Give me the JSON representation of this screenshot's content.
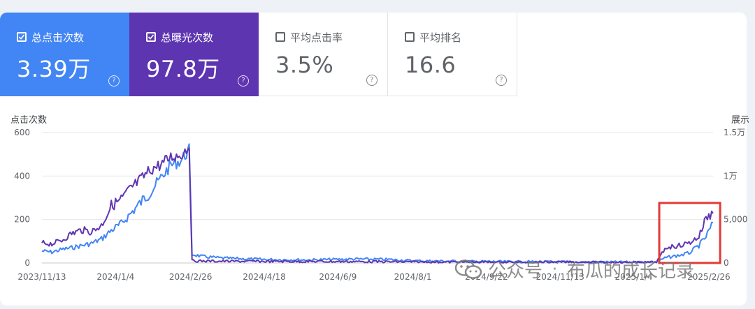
{
  "metrics": [
    {
      "label": "总点击次数",
      "value": "3.39万",
      "checked": true,
      "help": "?"
    },
    {
      "label": "总曝光次数",
      "value": "97.8万",
      "checked": true,
      "help": "?"
    },
    {
      "label": "平均点击率",
      "value": "3.5%",
      "checked": false,
      "help": "?"
    },
    {
      "label": "平均排名",
      "value": "16.6",
      "checked": false,
      "help": "?"
    }
  ],
  "colors": {
    "clicks": "#4285f4",
    "impressions": "#5e35b1",
    "highlight": "#e53935"
  },
  "watermark": {
    "prefix": "公众号",
    "separator": "·",
    "name": "布瓜的成长记录"
  },
  "chart_data": {
    "type": "line",
    "ylabel_left": "点击次数",
    "ylabel_right": "展示",
    "yticks_left": [
      "0",
      "200",
      "400",
      "600"
    ],
    "yticks_right": [
      "0",
      "5,000",
      "1万",
      "1.5万"
    ],
    "ylim_left": [
      0,
      600
    ],
    "ylim_right": [
      0,
      15000
    ],
    "xticks": [
      "2023/11/13",
      "2024/1/4",
      "2024/2/26",
      "2024/4/18",
      "2024/6/9",
      "2024/8/1",
      "2024/9/22",
      "2024/11/13",
      "2025/1/4",
      "2025/2/26"
    ],
    "x_range": [
      "2023/11/13",
      "2025/3/1"
    ],
    "grid": true,
    "series": [
      {
        "name": "总点击次数",
        "axis": "left",
        "color": "#4285f4",
        "points": [
          [
            "2023/11/13",
            55
          ],
          [
            "2023/11/20",
            50
          ],
          [
            "2023/11/27",
            62
          ],
          [
            "2023/12/4",
            70
          ],
          [
            "2023/12/11",
            80
          ],
          [
            "2023/12/18",
            90
          ],
          [
            "2023/12/25",
            110
          ],
          [
            "2024/1/1",
            150
          ],
          [
            "2024/1/8",
            180
          ],
          [
            "2024/1/15",
            230
          ],
          [
            "2024/1/22",
            280
          ],
          [
            "2024/1/29",
            330
          ],
          [
            "2024/2/5",
            390
          ],
          [
            "2024/2/12",
            450
          ],
          [
            "2024/2/19",
            470
          ],
          [
            "2024/2/25",
            520
          ],
          [
            "2024/2/27",
            40
          ],
          [
            "2024/3/5",
            30
          ],
          [
            "2024/3/20",
            22
          ],
          [
            "2024/4/18",
            16
          ],
          [
            "2024/5/20",
            14
          ],
          [
            "2024/6/20",
            18
          ],
          [
            "2024/7/15",
            16
          ],
          [
            "2024/8/1",
            10
          ],
          [
            "2024/9/1",
            8
          ],
          [
            "2024/10/1",
            6
          ],
          [
            "2024/11/13",
            5
          ],
          [
            "2024/12/15",
            4
          ],
          [
            "2025/1/4",
            4
          ],
          [
            "2025/1/20",
            5
          ],
          [
            "2025/1/27",
            25
          ],
          [
            "2025/2/5",
            35
          ],
          [
            "2025/2/12",
            45
          ],
          [
            "2025/2/19",
            80
          ],
          [
            "2025/2/24",
            120
          ],
          [
            "2025/3/1",
            185
          ]
        ]
      },
      {
        "name": "总曝光次数",
        "axis": "right",
        "color": "#5e35b1",
        "points": [
          [
            "2023/11/13",
            2300
          ],
          [
            "2023/11/20",
            2200
          ],
          [
            "2023/11/27",
            2600
          ],
          [
            "2023/12/4",
            3400
          ],
          [
            "2023/12/11",
            3800
          ],
          [
            "2023/12/18",
            3600
          ],
          [
            "2023/12/25",
            4300
          ],
          [
            "2024/1/1",
            6600
          ],
          [
            "2024/1/8",
            7300
          ],
          [
            "2024/1/15",
            8600
          ],
          [
            "2024/1/22",
            9600
          ],
          [
            "2024/1/29",
            10800
          ],
          [
            "2024/2/5",
            11300
          ],
          [
            "2024/2/12",
            12200
          ],
          [
            "2024/2/19",
            12400
          ],
          [
            "2024/2/25",
            13500
          ],
          [
            "2024/2/27",
            250
          ],
          [
            "2024/3/5",
            220
          ],
          [
            "2024/3/20",
            200
          ],
          [
            "2024/4/18",
            180
          ],
          [
            "2024/5/20",
            170
          ],
          [
            "2024/6/20",
            160
          ],
          [
            "2024/7/15",
            140
          ],
          [
            "2024/8/1",
            120
          ],
          [
            "2024/9/1",
            100
          ],
          [
            "2024/10/1",
            90
          ],
          [
            "2024/11/13",
            80
          ],
          [
            "2024/12/15",
            70
          ],
          [
            "2025/1/4",
            60
          ],
          [
            "2025/1/20",
            80
          ],
          [
            "2025/1/27",
            1800
          ],
          [
            "2025/2/5",
            2000
          ],
          [
            "2025/2/12",
            2300
          ],
          [
            "2025/2/19",
            3000
          ],
          [
            "2025/2/24",
            5200
          ],
          [
            "2025/3/1",
            5700
          ]
        ]
      }
    ],
    "annotation": {
      "type": "rectangle",
      "color": "#e53935",
      "x_range": [
        "2025/1/22",
        "2025/3/6"
      ]
    }
  }
}
